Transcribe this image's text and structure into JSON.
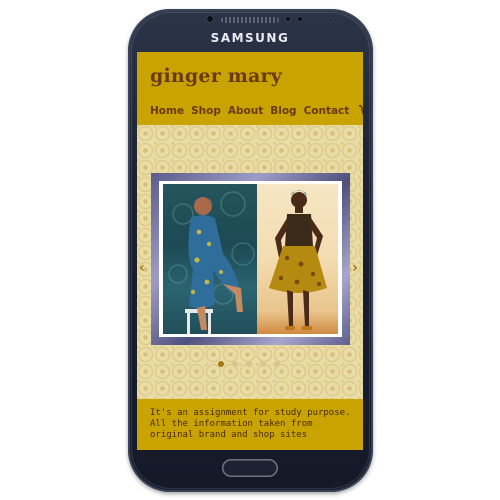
{
  "device": {
    "brand": "SAMSUNG",
    "body_color": "#1a2030"
  },
  "site": {
    "title": "ginger mary",
    "header_color": "#c9a300",
    "title_color": "#6b3a14"
  },
  "nav": {
    "items": [
      {
        "label": "Home"
      },
      {
        "label": "Shop"
      },
      {
        "label": "About"
      },
      {
        "label": "Blog"
      },
      {
        "label": "Contact"
      }
    ],
    "cart_icon": "shopping-cart-icon"
  },
  "slider": {
    "prev_icon": "chevron-left-icon",
    "next_icon": "chevron-right-icon",
    "prev_glyph": "‹",
    "next_glyph": "›",
    "slide_count": 5,
    "active_index": 0
  },
  "footer": {
    "text": "It's an assignment for study purpose. All the information taken from original brand and shop sites"
  }
}
